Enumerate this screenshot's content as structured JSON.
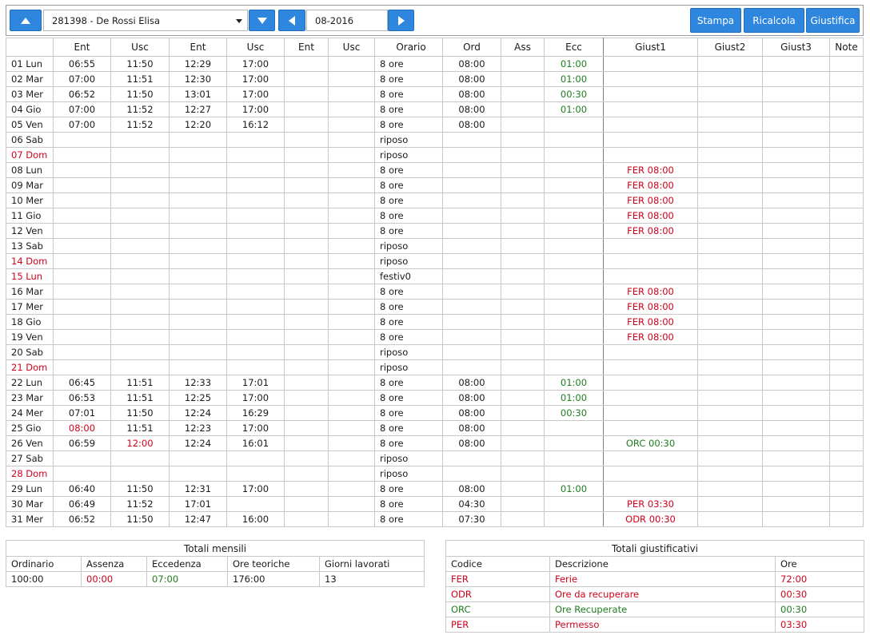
{
  "toolbar": {
    "employee": "281398 - De Rossi Elisa",
    "month": "08-2016",
    "stampa_label": "Stampa",
    "ricalcola_label": "Ricalcola",
    "giustifica_label": "Giustifica"
  },
  "colors": {
    "accent": "#2e86de",
    "red": "#d0021b",
    "green": "#1e7d1e"
  },
  "table": {
    "headers": [
      "",
      "Ent",
      "Usc",
      "Ent",
      "Usc",
      "Ent",
      "Usc",
      "Orario",
      "Ord",
      "Ass",
      "Ecc",
      "Giust1",
      "Giust2",
      "Giust3",
      "Note"
    ],
    "rows": [
      {
        "day": "01 Lun",
        "e1": "06:55",
        "u1": "11:50",
        "e2": "12:29",
        "u2": "17:00",
        "orario": "8 ore",
        "ord": "08:00",
        "ecc": "01:00"
      },
      {
        "day": "02 Mar",
        "e1": "07:00",
        "u1": "11:51",
        "e2": "12:30",
        "u2": "17:00",
        "orario": "8 ore",
        "ord": "08:00",
        "ecc": "01:00"
      },
      {
        "day": "03 Mer",
        "e1": "06:52",
        "u1": "11:50",
        "e2": "13:01",
        "u2": "17:00",
        "orario": "8 ore",
        "ord": "08:00",
        "ecc": "00:30"
      },
      {
        "day": "04 Gio",
        "e1": "07:00",
        "u1": "11:52",
        "e2": "12:27",
        "u2": "17:00",
        "orario": "8 ore",
        "ord": "08:00",
        "ecc": "01:00"
      },
      {
        "day": "05 Ven",
        "e1": "07:00",
        "u1": "11:52",
        "e2": "12:20",
        "u2": "16:12",
        "orario": "8 ore",
        "ord": "08:00"
      },
      {
        "day": "06 Sab",
        "orario": "riposo"
      },
      {
        "day": "07 Dom",
        "holiday": true,
        "orario": "riposo"
      },
      {
        "day": "08 Lun",
        "orario": "8 ore",
        "g1": "FER 08:00",
        "g1c": "red"
      },
      {
        "day": "09 Mar",
        "orario": "8 ore",
        "g1": "FER 08:00",
        "g1c": "red"
      },
      {
        "day": "10 Mer",
        "orario": "8 ore",
        "g1": "FER 08:00",
        "g1c": "red"
      },
      {
        "day": "11 Gio",
        "orario": "8 ore",
        "g1": "FER 08:00",
        "g1c": "red"
      },
      {
        "day": "12 Ven",
        "orario": "8 ore",
        "g1": "FER 08:00",
        "g1c": "red"
      },
      {
        "day": "13 Sab",
        "orario": "riposo"
      },
      {
        "day": "14 Dom",
        "holiday": true,
        "orario": "riposo"
      },
      {
        "day": "15 Lun",
        "holiday": true,
        "orario": "festiv0"
      },
      {
        "day": "16 Mar",
        "orario": "8 ore",
        "g1": "FER 08:00",
        "g1c": "red"
      },
      {
        "day": "17 Mer",
        "orario": "8 ore",
        "g1": "FER 08:00",
        "g1c": "red"
      },
      {
        "day": "18 Gio",
        "orario": "8 ore",
        "g1": "FER 08:00",
        "g1c": "red"
      },
      {
        "day": "19 Ven",
        "orario": "8 ore",
        "g1": "FER 08:00",
        "g1c": "red"
      },
      {
        "day": "20 Sab",
        "orario": "riposo"
      },
      {
        "day": "21 Dom",
        "holiday": true,
        "orario": "riposo"
      },
      {
        "day": "22 Lun",
        "e1": "06:45",
        "u1": "11:51",
        "e2": "12:33",
        "u2": "17:01",
        "orario": "8 ore",
        "ord": "08:00",
        "ecc": "01:00"
      },
      {
        "day": "23 Mar",
        "e1": "06:53",
        "u1": "11:51",
        "e2": "12:25",
        "u2": "17:00",
        "orario": "8 ore",
        "ord": "08:00",
        "ecc": "01:00"
      },
      {
        "day": "24 Mer",
        "e1": "07:01",
        "u1": "11:50",
        "e2": "12:24",
        "u2": "16:29",
        "orario": "8 ore",
        "ord": "08:00",
        "ecc": "00:30"
      },
      {
        "day": "25 Gio",
        "e1": "08:00",
        "e1c": "red",
        "u1": "11:51",
        "e2": "12:23",
        "u2": "17:00",
        "orario": "8 ore",
        "ord": "08:00"
      },
      {
        "day": "26 Ven",
        "e1": "06:59",
        "u1": "12:00",
        "u1c": "red",
        "e2": "12:24",
        "u2": "16:01",
        "orario": "8 ore",
        "ord": "08:00",
        "g1": "ORC 00:30",
        "g1c": "green"
      },
      {
        "day": "27 Sab",
        "orario": "riposo"
      },
      {
        "day": "28 Dom",
        "holiday": true,
        "orario": "riposo"
      },
      {
        "day": "29 Lun",
        "e1": "06:40",
        "u1": "11:50",
        "e2": "12:31",
        "u2": "17:00",
        "orario": "8 ore",
        "ord": "08:00",
        "ecc": "01:00"
      },
      {
        "day": "30 Mar",
        "e1": "06:49",
        "u1": "11:52",
        "e2": "17:01",
        "orario": "8 ore",
        "ord": "04:30",
        "g1": "PER 03:30",
        "g1c": "red"
      },
      {
        "day": "31 Mer",
        "e1": "06:52",
        "u1": "11:50",
        "e2": "12:47",
        "u2": "16:00",
        "orario": "8 ore",
        "ord": "07:30",
        "g1": "ODR 00:30",
        "g1c": "red"
      }
    ]
  },
  "totali_mensili": {
    "title": "Totali mensili",
    "headers": [
      "Ordinario",
      "Assenza",
      "Eccedenza",
      "Ore teoriche",
      "Giorni lavorati"
    ],
    "values": [
      "100:00",
      "00:00",
      "07:00",
      "176:00",
      "13"
    ]
  },
  "totali_giustificativi": {
    "title": "Totali giustificativi",
    "headers": [
      "Codice",
      "Descrizione",
      "Ore"
    ],
    "rows": [
      {
        "codice": "FER",
        "descrizione": "Ferie",
        "ore": "72:00",
        "color": "red"
      },
      {
        "codice": "ODR",
        "descrizione": "Ore da recuperare",
        "ore": "00:30",
        "color": "red"
      },
      {
        "codice": "ORC",
        "descrizione": "Ore Recuperate",
        "ore": "00:30",
        "color": "green"
      },
      {
        "codice": "PER",
        "descrizione": "Permesso",
        "ore": "03:30",
        "color": "red"
      }
    ]
  }
}
